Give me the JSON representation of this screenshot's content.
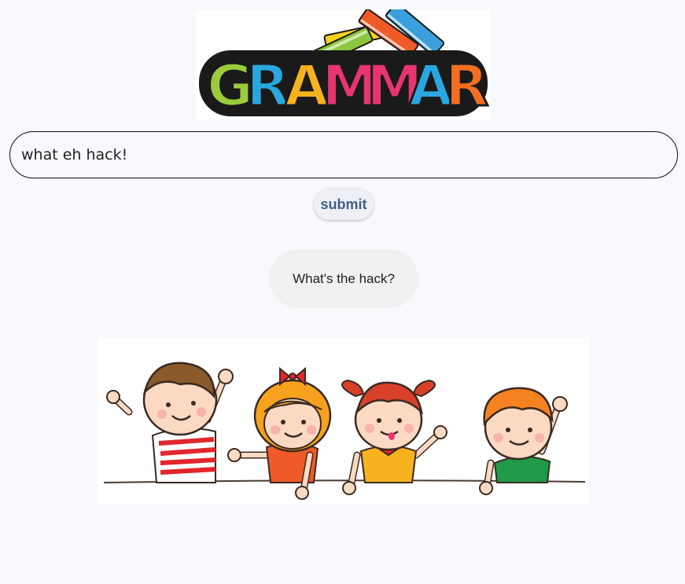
{
  "logo": {
    "text": "GRAMMAR",
    "letter_colors": [
      "#9ccc3c",
      "#2aa7e0",
      "#f7b21e",
      "#e6356f",
      "#e6356f",
      "#2aa7e0",
      "#f26f21"
    ],
    "outline_color": "#1a1a1a",
    "book_colors": [
      "#f5d21e",
      "#8dc63f",
      "#f05a28",
      "#3aa0dc"
    ]
  },
  "form": {
    "input_value": "what eh hack!",
    "submit_label": "submit"
  },
  "result": {
    "text": "What's the hack?"
  },
  "colors": {
    "page_background": "#f8f9fd",
    "submit_text": "#3f5f86",
    "bubble_background": "#f1f1f2"
  }
}
